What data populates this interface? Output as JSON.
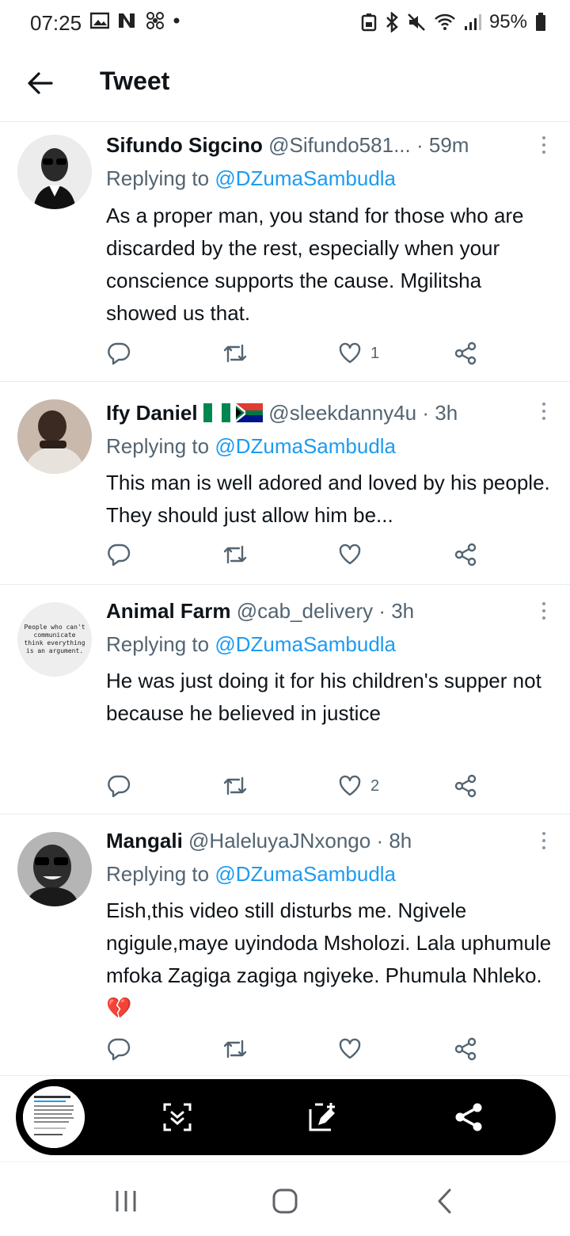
{
  "status_bar": {
    "time": "07:25",
    "battery": "95%"
  },
  "header": {
    "title": "Tweet"
  },
  "tweets": [
    {
      "name": "Sifundo Sigcino",
      "handle": "@Sifundo581...",
      "time": "· 59m",
      "replying_label": "Replying to",
      "replying_to": "@DZumaSambudla",
      "text": "As a proper man, you stand for those who are discarded by the rest, especially when your conscience supports the cause. Mgilitsha showed us that.",
      "likes": "1"
    },
    {
      "name": "Ify Daniel",
      "handle": "@sleekdanny4u",
      "time": "· 3h",
      "replying_label": "Replying to",
      "replying_to": "@DZumaSambudla",
      "text": "This man is well adored and loved by his people. They should just allow him be...",
      "likes": ""
    },
    {
      "name": "Animal Farm",
      "handle": "@cab_delivery",
      "time": "· 3h",
      "replying_label": "Replying to",
      "replying_to": "@DZumaSambudla",
      "text": "He was just doing it for his children's supper not because he believed in justice",
      "likes": "2",
      "avatar_text": "People who can't communicate think everything is an argument."
    },
    {
      "name": "Mangali",
      "handle": "@HaleluyaJNxongo",
      "time": "· 8h",
      "replying_label": "Replying to",
      "replying_to": "@DZumaSambudla",
      "text": "Eish,this video still disturbs me. Ngivele ngigule,maye uyindoda Msholozi. Lala uphumule mfoka Zagiga zagiga ngiyeke. Phumula Nhleko.💔",
      "likes": ""
    }
  ],
  "colors": {
    "link": "#1d9bf0",
    "secondary_text": "#536471",
    "divider": "#e6ecf0"
  },
  "icons": [
    "back-arrow-icon",
    "reply-icon",
    "retweet-icon",
    "like-icon",
    "share-icon",
    "more-icon",
    "scroll-capture-icon",
    "draw-icon",
    "share-icon",
    "recents-icon",
    "home-icon",
    "back-icon"
  ]
}
